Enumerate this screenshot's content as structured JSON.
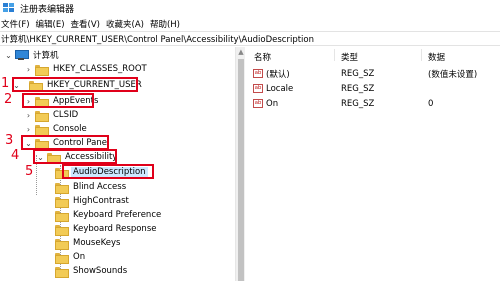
{
  "window": {
    "title": "注册表编辑器"
  },
  "menu": [
    "文件(F)",
    "编辑(E)",
    "查看(V)",
    "收藏夹(A)",
    "帮助(H)"
  ],
  "address": "计算机\\HKEY_CURRENT_USER\\Control Panel\\Accessibility\\AudioDescription",
  "tree": {
    "root": "计算机",
    "classes_root": "HKEY_CLASSES_ROOT",
    "current_user": "HKEY_CURRENT_USER",
    "appevents": "AppEvents",
    "clsid": "CLSID",
    "console": "Console",
    "control_panel": "Control Panel",
    "accessibility": "Accessibility",
    "audio_description": "AudioDescription",
    "children": [
      "Blind Access",
      "HighContrast",
      "Keyboard Preference",
      "Keyboard Response",
      "MouseKeys",
      "On",
      "ShowSounds"
    ]
  },
  "annotations": [
    "1",
    "2",
    "3",
    "4",
    "5"
  ],
  "values_table": {
    "headers": {
      "name": "名称",
      "type": "类型",
      "data": "数据"
    },
    "rows": [
      {
        "name": "(默认)",
        "type": "REG_SZ",
        "data": "(数值未设置)"
      },
      {
        "name": "Locale",
        "type": "REG_SZ",
        "data": ""
      },
      {
        "name": "On",
        "type": "REG_SZ",
        "data": "0"
      }
    ]
  },
  "icons": {
    "value_icon": "ab",
    "expand_collapsed": "›",
    "expand_open": "⌄",
    "scroll_up": "▲"
  },
  "colors": {
    "annotation": "#e0001a",
    "selection": "#cce8ff",
    "folder": "#f2cb56"
  }
}
